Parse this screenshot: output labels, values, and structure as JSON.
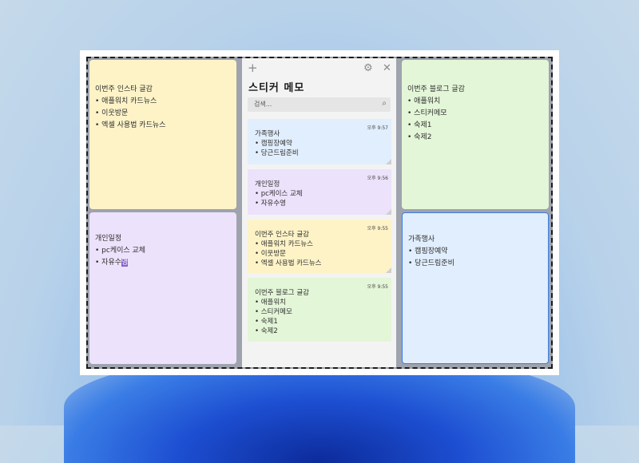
{
  "colors": {
    "yellow": "#fdf3c7",
    "purple": "#ece2fb",
    "green": "#e3f6d7",
    "blue": "#e1eefd",
    "panel": "#f3f3f3"
  },
  "left_notes": {
    "top": {
      "lines": [
        "이번주 인스타 글감",
        "• 애플워치 카드뉴스",
        "• 이웃방문",
        "• 엑셀 사용법 카드뉴스"
      ]
    },
    "bottom": {
      "lines": [
        "개인일정",
        "• pc케이스 교체"
      ],
      "last_prefix": "• 자유수",
      "last_highlight": "영"
    }
  },
  "right_notes": {
    "top": {
      "lines": [
        "이번주 블로그 글감",
        "• 애플워치",
        "• 스티커메모",
        "• 숙제1",
        "• 숙제2"
      ]
    },
    "bottom": {
      "lines": [
        "가족행사",
        "• 캠핑장예약",
        "• 당근드림준비"
      ]
    }
  },
  "panel": {
    "title": "스티커 메모",
    "add_icon": "plus-icon",
    "settings_icon": "gear-icon",
    "close_icon": "close-icon",
    "search_placeholder": "검색...",
    "search_icon": "search-icon",
    "cards": [
      {
        "time": "오후 9:57",
        "color": "blue",
        "lines": [
          "가족행사",
          "• 캠핑장예약",
          "• 당근드림준비"
        ]
      },
      {
        "time": "오후 9:56",
        "color": "purple",
        "lines": [
          "개인일정",
          "• pc케이스 교체",
          "• 자유수영"
        ]
      },
      {
        "time": "오후 9:55",
        "color": "yellow",
        "lines": [
          "이번주 인스타 글감",
          "• 애플워치 카드뉴스",
          "• 이웃방문",
          "• 엑셀 사용법 카드뉴스"
        ]
      },
      {
        "time": "오후 9:55",
        "color": "green",
        "lines": [
          "이번주 블로그 글감",
          "• 애플워치",
          "• 스티커메모",
          "• 숙제1",
          "• 숙제2"
        ]
      }
    ]
  }
}
